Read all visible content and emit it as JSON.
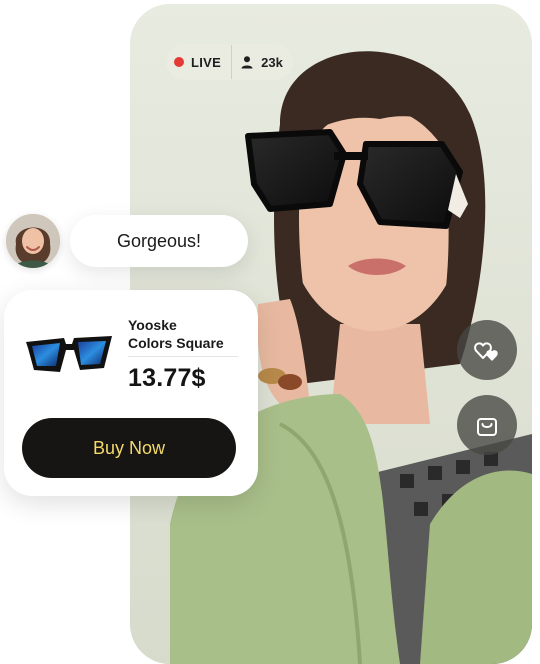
{
  "live": {
    "label": "LIVE",
    "dot_color": "#e53935",
    "viewers": "23k"
  },
  "actions": {
    "like_icon": "hearts-icon",
    "bag_icon": "shopping-bag-icon"
  },
  "comment": {
    "text": "Gorgeous!",
    "avatar_icon": "avatar"
  },
  "product": {
    "name_line1": "Yooske",
    "name_line2": "Colors Square",
    "price": "13.77$",
    "buy_label": "Buy Now",
    "buy_text_color": "#f3d96a",
    "buy_bg_color": "#171514"
  }
}
